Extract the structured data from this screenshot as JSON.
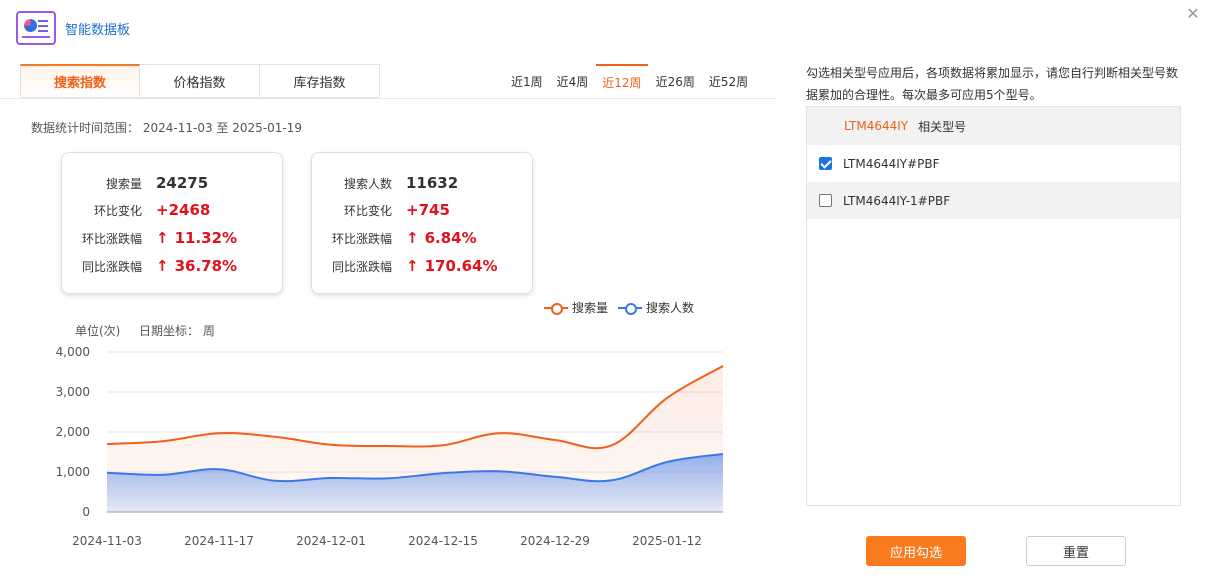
{
  "app": {
    "title": "智能数据板",
    "logo_icon": "dashboard-icon",
    "close_icon": "close-icon"
  },
  "tabs": [
    {
      "label": "搜索指数",
      "active": true
    },
    {
      "label": "价格指数",
      "active": false
    },
    {
      "label": "库存指数",
      "active": false
    }
  ],
  "periods": [
    {
      "label": "近1周",
      "active": false
    },
    {
      "label": "近4周",
      "active": false
    },
    {
      "label": "近12周",
      "active": true
    },
    {
      "label": "近26周",
      "active": false
    },
    {
      "label": "近52周",
      "active": false
    }
  ],
  "range": {
    "label": "数据统计时间范围：",
    "value": "2024-11-03 至 2025-01-19"
  },
  "cards": [
    {
      "rows": [
        {
          "label": "搜索量",
          "value": "24275"
        },
        {
          "label": "环比变化",
          "value": "+2468"
        },
        {
          "label": "环比涨跌幅",
          "arrow": "↑",
          "value": "11.32%"
        },
        {
          "label": "同比涨跌幅",
          "arrow": "↑",
          "value": "36.78%"
        }
      ]
    },
    {
      "rows": [
        {
          "label": "搜索人数",
          "value": "11632"
        },
        {
          "label": "环比变化",
          "value": "+745"
        },
        {
          "label": "环比涨跌幅",
          "arrow": "↑",
          "value": "6.84%"
        },
        {
          "label": "同比涨跌幅",
          "arrow": "↑",
          "value": "170.64%"
        }
      ]
    }
  ],
  "chart_info": {
    "unit": "单位(次)",
    "date_axis": "日期坐标：  周"
  },
  "chart_data": {
    "type": "area",
    "x": [
      "2024-11-03",
      "2024-11-10",
      "2024-11-17",
      "2024-11-24",
      "2024-12-01",
      "2024-12-08",
      "2024-12-15",
      "2024-12-22",
      "2024-12-29",
      "2025-01-05",
      "2025-01-12",
      "2025-01-19"
    ],
    "x_tick_labels": [
      "2024-11-03",
      "2024-11-17",
      "2024-12-01",
      "2024-12-15",
      "2024-12-29",
      "2025-01-12"
    ],
    "y_ticks": [
      "0",
      "1,000",
      "2,000",
      "3,000",
      "4,000"
    ],
    "ylim": [
      0,
      4000
    ],
    "grid": true,
    "legend_position": "top-right",
    "series": [
      {
        "name": "搜索量",
        "color": "#f0601a",
        "values": [
          1700,
          1770,
          1970,
          1880,
          1680,
          1650,
          1670,
          1970,
          1800,
          1660,
          2850,
          3650
        ]
      },
      {
        "name": "搜索人数",
        "color": "#3b78e7",
        "values": [
          980,
          930,
          1070,
          780,
          850,
          840,
          970,
          1020,
          880,
          790,
          1250,
          1450
        ]
      }
    ]
  },
  "models": {
    "note": "勾选相关型号应用后，各项数据将累加显示，请您自行判断相关型号数据累加的合理性。每次最多可应用5个型号。",
    "header_main": "LTM4644IY",
    "header_sub": "相关型号",
    "items": [
      {
        "label": "LTM4644IY#PBF",
        "checked": true
      },
      {
        "label": "LTM4644IY-1#PBF",
        "checked": false
      }
    ]
  },
  "buttons": {
    "apply": "应用勾选",
    "reset": "重置"
  }
}
